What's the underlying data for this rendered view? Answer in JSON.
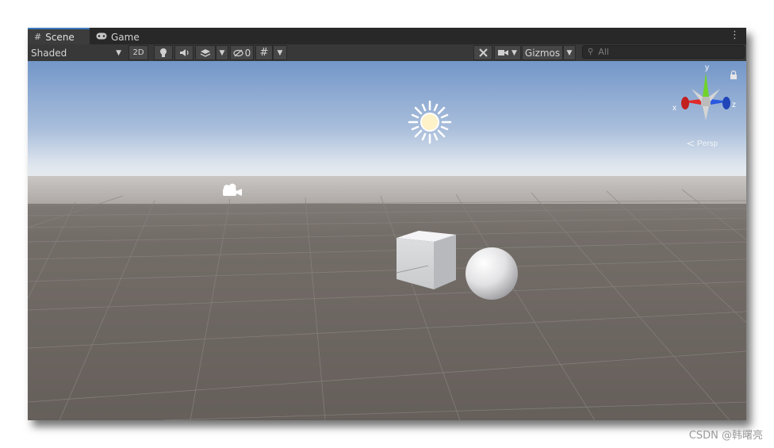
{
  "tabs": [
    {
      "label": "Scene",
      "icon": "grid-icon"
    },
    {
      "label": "Game",
      "icon": "gamepad-icon"
    }
  ],
  "toolbar": {
    "shading_mode": "Shaded",
    "mode_2d": "2D",
    "hidden_count": "0",
    "gizmos_label": "Gizmos",
    "search_placeholder": "All"
  },
  "gizmo": {
    "x_label": "x",
    "y_label": "y",
    "z_label": "z",
    "projection_label": "Persp",
    "colors": {
      "x": "#e02a2a",
      "y": "#6fd32b",
      "z": "#2a58e0"
    }
  },
  "scene": {
    "objects": [
      "directional-light",
      "camera",
      "cube",
      "sphere"
    ],
    "sky_top_color": "#7397c9",
    "horizon_color": "#dfe6ee",
    "ground_color": "#665f5b"
  },
  "watermark": "CSDN @韩曙亮"
}
